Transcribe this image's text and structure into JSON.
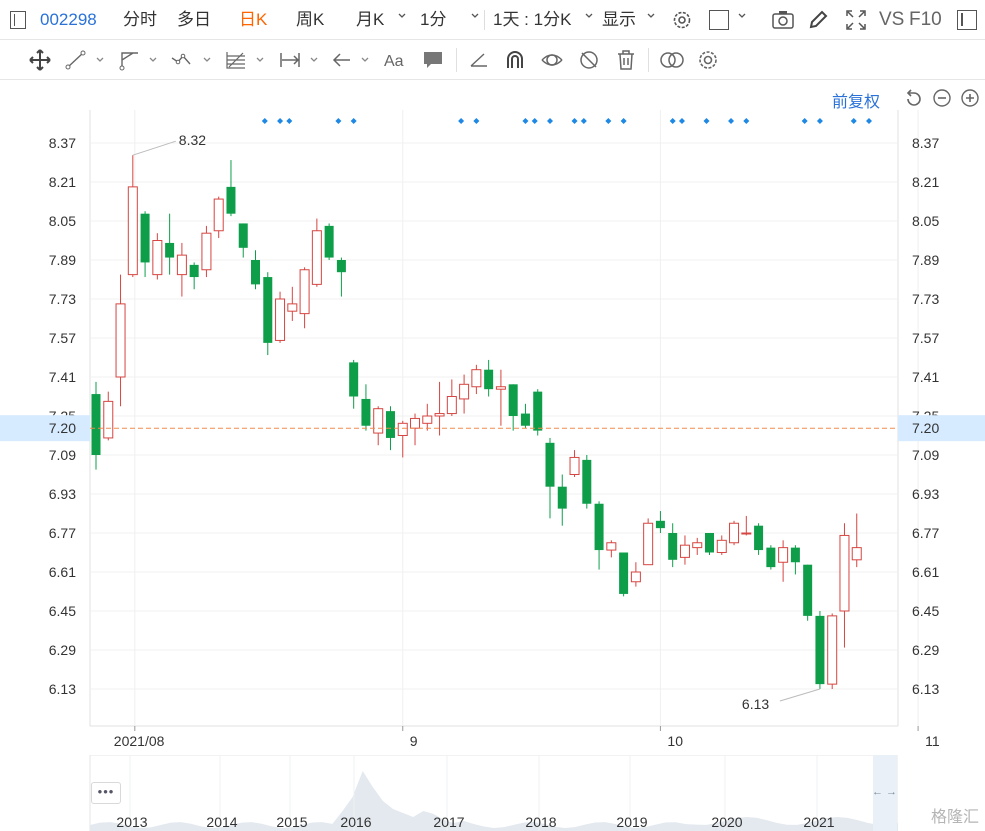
{
  "toolbar": {
    "code": "002298",
    "fenshi": "分时",
    "duori": "多日",
    "rik": "日K",
    "zhouk": "周K",
    "yuek": "月K",
    "min": "1分",
    "multi": "1天 : 1分K",
    "show": "显示",
    "vs": "VS",
    "f10": "F10"
  },
  "price_adjust": "前复权",
  "current_price": "7.20",
  "colors": {
    "up": "#d64541",
    "down": "#0e9e4a",
    "accent": "#2a72d8",
    "active_tab": "#ff6600",
    "price_line": "#f08a4b"
  },
  "icons": [
    "crosshair-move-icon",
    "line-tool-icon",
    "channel-tool-icon",
    "wave-tool-icon",
    "fib-tool-icon",
    "measure-tool-icon",
    "arrow-tool-icon",
    "text-tool-icon",
    "comment-tool-icon",
    "eraser-icon",
    "magnet-icon",
    "lock-drawings-icon",
    "hide-drawings-icon",
    "trash-icon",
    "compare-icon",
    "settings-icon"
  ],
  "chart_data": {
    "type": "candlestick",
    "ylim": [
      6.02,
      8.46
    ],
    "y_ticks": [
      "8.37",
      "8.21",
      "8.05",
      "7.89",
      "7.73",
      "7.57",
      "7.41",
      "7.25",
      "7.09",
      "6.93",
      "6.77",
      "6.61",
      "6.45",
      "6.29",
      "6.13"
    ],
    "x_ticks": [
      {
        "label": "2021/08",
        "index": 3
      },
      {
        "label": "9",
        "index": 25
      },
      {
        "label": "10",
        "index": 46
      },
      {
        "label": "11",
        "index": 67
      }
    ],
    "max_label": "8.32",
    "min_label": "6.13",
    "candles": [
      [
        7.34,
        7.09,
        7.39,
        7.03
      ],
      [
        7.16,
        7.31,
        7.35,
        7.15
      ],
      [
        7.41,
        7.71,
        7.83,
        7.29
      ],
      [
        7.83,
        8.19,
        8.32,
        7.82
      ],
      [
        8.08,
        7.88,
        8.09,
        7.82
      ],
      [
        7.83,
        7.97,
        8.0,
        7.81
      ],
      [
        7.96,
        7.9,
        8.08,
        7.83
      ],
      [
        7.83,
        7.91,
        7.96,
        7.74
      ],
      [
        7.87,
        7.82,
        7.88,
        7.77
      ],
      [
        7.85,
        8.0,
        8.03,
        7.82
      ],
      [
        8.01,
        8.14,
        8.15,
        7.98
      ],
      [
        8.19,
        8.08,
        8.3,
        8.07
      ],
      [
        8.04,
        7.94,
        8.04,
        7.9
      ],
      [
        7.89,
        7.79,
        7.93,
        7.77
      ],
      [
        7.82,
        7.55,
        7.84,
        7.5
      ],
      [
        7.56,
        7.73,
        7.76,
        7.55
      ],
      [
        7.68,
        7.71,
        7.78,
        7.64
      ],
      [
        7.67,
        7.85,
        7.86,
        7.61
      ],
      [
        7.79,
        8.01,
        8.06,
        7.78
      ],
      [
        8.03,
        7.9,
        8.04,
        7.89
      ],
      [
        7.89,
        7.84,
        7.9,
        7.74
      ],
      [
        7.47,
        7.33,
        7.48,
        7.28
      ],
      [
        7.32,
        7.21,
        7.38,
        7.19
      ],
      [
        7.18,
        7.28,
        7.29,
        7.13
      ],
      [
        7.27,
        7.16,
        7.29,
        7.11
      ],
      [
        7.17,
        7.22,
        7.23,
        7.08
      ],
      [
        7.2,
        7.24,
        7.26,
        7.13
      ],
      [
        7.22,
        7.25,
        7.3,
        7.19
      ],
      [
        7.25,
        7.26,
        7.39,
        7.17
      ],
      [
        7.26,
        7.33,
        7.4,
        7.25
      ],
      [
        7.32,
        7.38,
        7.42,
        7.26
      ],
      [
        7.37,
        7.44,
        7.46,
        7.34
      ],
      [
        7.44,
        7.36,
        7.48,
        7.33
      ],
      [
        7.36,
        7.37,
        7.44,
        7.21
      ],
      [
        7.38,
        7.25,
        7.38,
        7.19
      ],
      [
        7.26,
        7.21,
        7.3,
        7.2
      ],
      [
        7.35,
        7.19,
        7.36,
        7.17
      ],
      [
        7.14,
        6.96,
        7.16,
        6.83
      ],
      [
        6.96,
        6.87,
        7.01,
        6.8
      ],
      [
        7.01,
        7.08,
        7.11,
        7.0
      ],
      [
        7.07,
        6.89,
        7.09,
        6.87
      ],
      [
        6.89,
        6.7,
        6.9,
        6.62
      ],
      [
        6.7,
        6.73,
        6.74,
        6.67
      ],
      [
        6.69,
        6.52,
        6.69,
        6.51
      ],
      [
        6.57,
        6.61,
        6.65,
        6.55
      ],
      [
        6.64,
        6.81,
        6.83,
        6.64
      ],
      [
        6.82,
        6.79,
        6.86,
        6.77
      ],
      [
        6.77,
        6.66,
        6.81,
        6.63
      ],
      [
        6.67,
        6.72,
        6.76,
        6.64
      ],
      [
        6.71,
        6.73,
        6.75,
        6.68
      ],
      [
        6.77,
        6.69,
        6.77,
        6.68
      ],
      [
        6.69,
        6.74,
        6.76,
        6.68
      ],
      [
        6.73,
        6.81,
        6.82,
        6.72
      ],
      [
        6.77,
        6.77,
        6.84,
        6.76
      ],
      [
        6.8,
        6.7,
        6.81,
        6.68
      ],
      [
        6.71,
        6.63,
        6.72,
        6.62
      ],
      [
        6.65,
        6.71,
        6.74,
        6.57
      ],
      [
        6.71,
        6.65,
        6.72,
        6.6
      ],
      [
        6.64,
        6.43,
        6.64,
        6.41
      ],
      [
        6.43,
        6.15,
        6.45,
        6.13
      ],
      [
        6.15,
        6.43,
        6.44,
        6.13
      ],
      [
        6.45,
        6.76,
        6.81,
        6.3
      ],
      [
        6.66,
        6.71,
        6.85,
        6.63
      ]
    ]
  },
  "navigator": {
    "years": [
      "2013",
      "2014",
      "2015",
      "2016",
      "2017",
      "2018",
      "2019",
      "2020",
      "2021"
    ],
    "menu": "•••",
    "arrows": "← →"
  },
  "watermark": "格隆汇"
}
